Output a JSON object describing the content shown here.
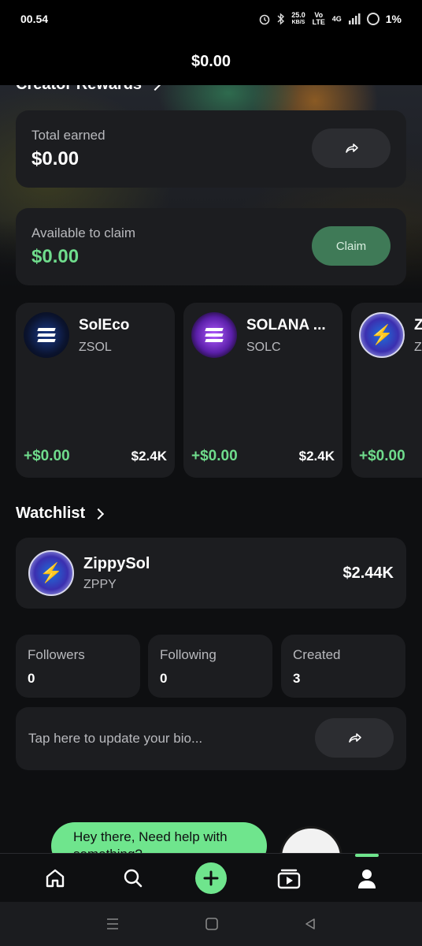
{
  "status_bar": {
    "time": "00.54",
    "speed_value": "25.0",
    "speed_unit": "KB/S",
    "volte": "Vo LTE",
    "network": "4G",
    "battery": "1%"
  },
  "header": {
    "balance": "$0.00"
  },
  "creator_rewards": {
    "title": "Creator Rewards",
    "total_label": "Total earned",
    "total_value": "$0.00",
    "available_label": "Available to claim",
    "available_value": "$0.00",
    "claim_label": "Claim"
  },
  "tokens": [
    {
      "name": "SolEco",
      "ticker": "ZSOL",
      "change": "+$0.00",
      "market_cap": "$2.4K",
      "logo": "soleco-logo"
    },
    {
      "name": "SOLANA ...",
      "ticker": "SOLC",
      "change": "+$0.00",
      "market_cap": "$2.4K",
      "logo": "solana-logo"
    },
    {
      "name": "Z",
      "ticker": "Z",
      "change": "+$0.00",
      "market_cap": "",
      "logo": "zippysol-logo"
    }
  ],
  "watchlist": {
    "title": "Watchlist",
    "items": [
      {
        "name": "ZippySol",
        "ticker": "ZPPY",
        "price": "$2.44K",
        "logo": "zippysol-logo"
      }
    ]
  },
  "stats": [
    {
      "label": "Followers",
      "value": "0"
    },
    {
      "label": "Following",
      "value": "0"
    },
    {
      "label": "Created",
      "value": "3"
    }
  ],
  "bio": {
    "placeholder": "Tap here to update your bio..."
  },
  "help": {
    "text": "Hey there, Need help with something?"
  },
  "colors": {
    "accent": "#6fe58d",
    "positive": "#6fdc8c",
    "claim_button": "#3f7a57",
    "card": "#1c1d20"
  }
}
